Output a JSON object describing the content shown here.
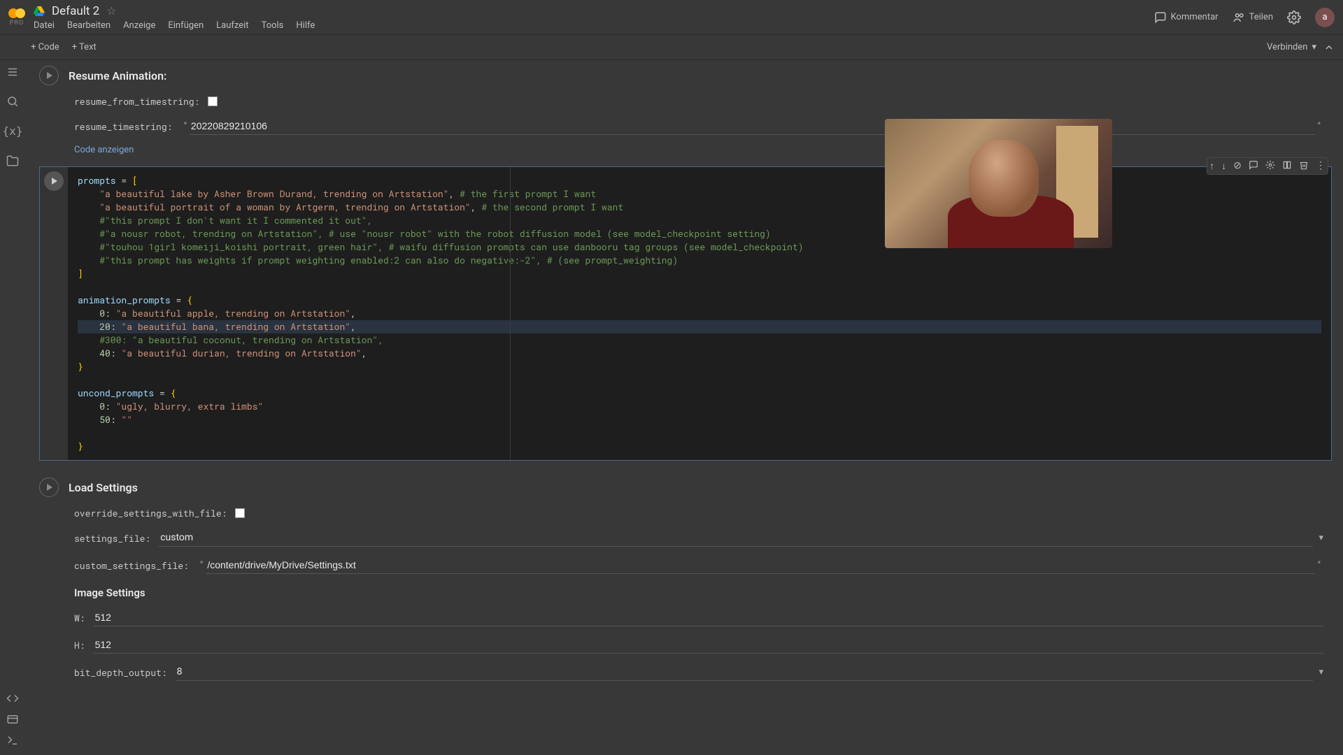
{
  "header": {
    "logo_sub": "PRO",
    "doc_title": "Default 2",
    "menu": [
      "Datei",
      "Bearbeiten",
      "Anzeige",
      "Einfügen",
      "Laufzeit",
      "Tools",
      "Hilfe"
    ],
    "comment": "Kommentar",
    "share": "Teilen",
    "avatar_letter": "a"
  },
  "toolbar": {
    "add_code": "+ Code",
    "add_text": "+ Text",
    "connect": "Verbinden"
  },
  "resume": {
    "title": "Resume Animation:",
    "from_timestring_label": "resume_from_timestring:",
    "timestring_label": "resume_timestring:",
    "timestring_value": "20220829210106",
    "show_code": "Code anzeigen"
  },
  "code": {
    "l1": "prompts = [",
    "l2_a": "    \"a beautiful lake by Asher Brown Durand, trending on Artstation\"",
    "l2_b": ", ",
    "l2_c": "# the first prompt I want",
    "l3_a": "    \"a beautiful portrait of a woman by Artgerm, trending on Artstation\"",
    "l3_b": ", ",
    "l3_c": "# the second prompt I want",
    "l4": "    #\"this prompt I don't want it I commented it out\",",
    "l5": "    #\"a nousr robot, trending on Artstation\", # use \"nousr robot\" with the robot diffusion model (see model_checkpoint setting)",
    "l6": "    #\"touhou 1girl komeiji_koishi portrait, green hair\", # waifu diffusion prompts can use danbooru tag groups (see model_checkpoint)",
    "l7": "    #\"this prompt has weights if prompt weighting enabled:2 can also do negative:-2\", # (see prompt_weighting)",
    "l8": "]",
    "l10": "animation_prompts = {",
    "l11_a": "    0",
    "l11_b": ": ",
    "l11_c": "\"a beautiful apple, trending on Artstation\"",
    "l11_d": ",",
    "l12_a": "    20",
    "l12_b": ": ",
    "l12_c": "\"a beautiful bana, trending on Artstation\"",
    "l12_d": ",",
    "l13": "    #300: \"a beautiful coconut, trending on Artstation\",",
    "l14_a": "    40",
    "l14_b": ": ",
    "l14_c": "\"a beautiful durian, trending on Artstation\"",
    "l14_d": ",",
    "l15": "}",
    "l17": "uncond_prompts = {",
    "l18_a": "    0",
    "l18_b": ": ",
    "l18_c": "\"ugly, blurry, extra limbs\"",
    "l19_a": "    50",
    "l19_b": ": ",
    "l19_c": "\"\"",
    "l21": "}"
  },
  "load": {
    "title": "Load Settings",
    "override_label": "override_settings_with_file:",
    "settings_file_label": "settings_file:",
    "settings_file_value": "custom",
    "custom_file_label": "custom_settings_file:",
    "custom_file_value": "/content/drive/MyDrive/Settings.txt"
  },
  "image": {
    "title": "Image Settings",
    "w_label": "W:",
    "w_value": "512",
    "h_label": "H:",
    "h_value": "512",
    "bit_label": "bit_depth_output:",
    "bit_value": "8"
  }
}
